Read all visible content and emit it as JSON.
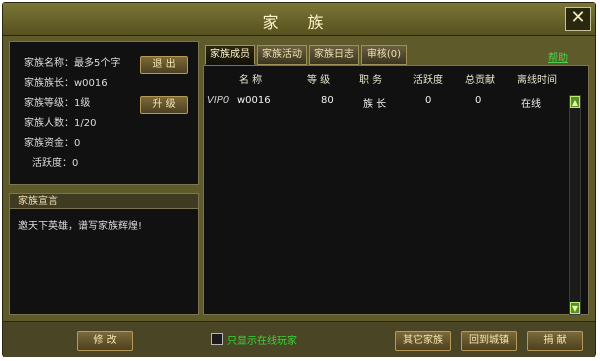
{
  "window": {
    "title": "家 族",
    "close_icon": "close-icon"
  },
  "left_info": {
    "name": "家族名称：最多5个字",
    "leader": "家族族长：w0016",
    "level": "家族等级：1级",
    "members": "家族人数：1/20",
    "funds": "家族资金：0",
    "activity": "活跃度：0",
    "btn_quit": "退 出",
    "btn_upgrade": "升 级"
  },
  "declaration": {
    "header": "家族宣言",
    "text": "邀天下英雄，谱写家族辉煌!"
  },
  "tabs": [
    {
      "label": "家族成员",
      "active": true
    },
    {
      "label": "家族活动",
      "active": false
    },
    {
      "label": "家族日志",
      "active": false
    },
    {
      "label": "审核(0)",
      "active": false
    }
  ],
  "help": "帮助",
  "table": {
    "headers": [
      "名 称",
      "等 级",
      "职 务",
      "活跃度",
      "总贡献",
      "离线时间"
    ],
    "rows": [
      {
        "vip": "VIP0",
        "name": "w0016",
        "level": "80",
        "role": "族 长",
        "activity": "0",
        "contribution": "0",
        "offline": "在线"
      }
    ]
  },
  "footer": {
    "btn_modify": "修 改",
    "checkbox_label": "只显示在线玩家",
    "btn_other": "其它家族",
    "btn_return": "回到城镇",
    "btn_donate": "捐 献"
  }
}
